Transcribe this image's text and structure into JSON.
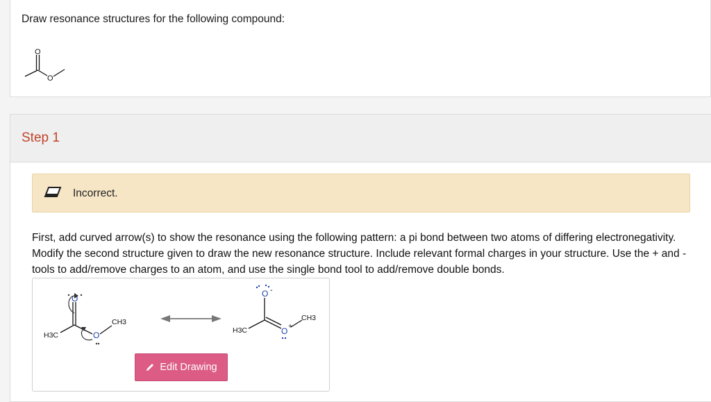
{
  "question": {
    "prompt": "Draw resonance structures for the following compound:",
    "compound_atom_label": "O"
  },
  "step": {
    "title": "Step 1",
    "feedback": {
      "icon": "eraser-icon",
      "text": "Incorrect."
    },
    "instructions": "First, add curved arrow(s) to show the resonance using the following pattern: a pi bond between two atoms of differing electronegativity. Modify the second structure given to draw the new resonance structure. Include relevant formal charges in your structure. Use the + and - tools to add/remove charges to an atom, and use the single bond tool to add/remove double bonds.",
    "drawing": {
      "left_structure": {
        "methyl_left": "H3C",
        "methyl_right": "CH3",
        "oxygen": "O"
      },
      "right_structure": {
        "methyl_left": "H3C",
        "methyl_right": "CH3",
        "oxygen": "O",
        "charge_minus": "-",
        "charge_plus": "+"
      },
      "edit_button_label": "Edit Drawing",
      "edit_button_icon": "pencil-icon"
    }
  },
  "colors": {
    "step_title": "#c0452b",
    "feedback_bg": "#f6e6c6",
    "edit_button": "#dc5c86",
    "oxygen": "#1e3fae"
  }
}
